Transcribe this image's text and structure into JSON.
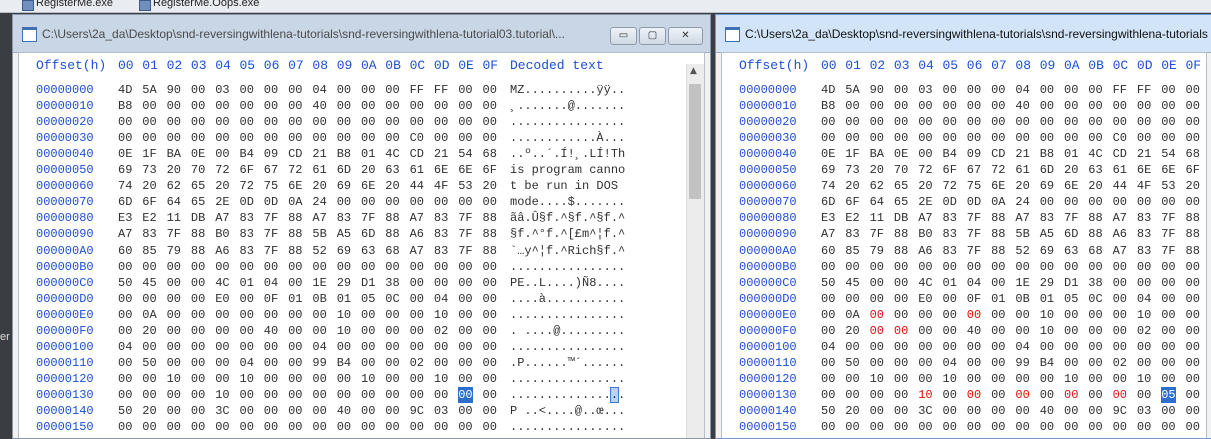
{
  "taskbar": {
    "items": [
      {
        "label": "RegisterMe.exe"
      },
      {
        "label": "RegisterMe.Oops.exe"
      }
    ],
    "side_peek": "er"
  },
  "left_window": {
    "title": "C:\\Users\\2a_da\\Desktop\\snd-reversingwithlena-tutorials\\snd-reversingwithlena-tutorial03.tutorial\\...",
    "buttons": {
      "minimize": "▭",
      "maximize": "▢",
      "close": "✕"
    },
    "header": {
      "offset": "Offset(h)",
      "columns": [
        "00",
        "01",
        "02",
        "03",
        "04",
        "05",
        "06",
        "07",
        "08",
        "09",
        "0A",
        "0B",
        "0C",
        "0D",
        "0E",
        "0F"
      ],
      "decoded": "Decoded text"
    },
    "rows": [
      {
        "offset": "00000000",
        "bytes": [
          "4D",
          "5A",
          "90",
          "00",
          "03",
          "00",
          "00",
          "00",
          "04",
          "00",
          "00",
          "00",
          "FF",
          "FF",
          "00",
          "00"
        ],
        "text": "MZ..........ÿÿ.."
      },
      {
        "offset": "00000010",
        "bytes": [
          "B8",
          "00",
          "00",
          "00",
          "00",
          "00",
          "00",
          "00",
          "40",
          "00",
          "00",
          "00",
          "00",
          "00",
          "00",
          "00"
        ],
        "text": "¸.......@......."
      },
      {
        "offset": "00000020",
        "bytes": [
          "00",
          "00",
          "00",
          "00",
          "00",
          "00",
          "00",
          "00",
          "00",
          "00",
          "00",
          "00",
          "00",
          "00",
          "00",
          "00"
        ],
        "text": "................"
      },
      {
        "offset": "00000030",
        "bytes": [
          "00",
          "00",
          "00",
          "00",
          "00",
          "00",
          "00",
          "00",
          "00",
          "00",
          "00",
          "00",
          "C0",
          "00",
          "00",
          "00"
        ],
        "text": "............À..."
      },
      {
        "offset": "00000040",
        "bytes": [
          "0E",
          "1F",
          "BA",
          "0E",
          "00",
          "B4",
          "09",
          "CD",
          "21",
          "B8",
          "01",
          "4C",
          "CD",
          "21",
          "54",
          "68"
        ],
        "text": "..º..´.Í!¸.LÍ!Th"
      },
      {
        "offset": "00000050",
        "bytes": [
          "69",
          "73",
          "20",
          "70",
          "72",
          "6F",
          "67",
          "72",
          "61",
          "6D",
          "20",
          "63",
          "61",
          "6E",
          "6E",
          "6F"
        ],
        "text": "is program canno"
      },
      {
        "offset": "00000060",
        "bytes": [
          "74",
          "20",
          "62",
          "65",
          "20",
          "72",
          "75",
          "6E",
          "20",
          "69",
          "6E",
          "20",
          "44",
          "4F",
          "53",
          "20"
        ],
        "text": "t be run in DOS "
      },
      {
        "offset": "00000070",
        "bytes": [
          "6D",
          "6F",
          "64",
          "65",
          "2E",
          "0D",
          "0D",
          "0A",
          "24",
          "00",
          "00",
          "00",
          "00",
          "00",
          "00",
          "00"
        ],
        "text": "mode....$......."
      },
      {
        "offset": "00000080",
        "bytes": [
          "E3",
          "E2",
          "11",
          "DB",
          "A7",
          "83",
          "7F",
          "88",
          "A7",
          "83",
          "7F",
          "88",
          "A7",
          "83",
          "7F",
          "88"
        ],
        "text": "ãâ.Û§f.^§f.^§f.^"
      },
      {
        "offset": "00000090",
        "bytes": [
          "A7",
          "83",
          "7F",
          "88",
          "B0",
          "83",
          "7F",
          "88",
          "5B",
          "A5",
          "6D",
          "88",
          "A6",
          "83",
          "7F",
          "88"
        ],
        "text": "§f.^°f.^[£m^¦f.^"
      },
      {
        "offset": "000000A0",
        "bytes": [
          "60",
          "85",
          "79",
          "88",
          "A6",
          "83",
          "7F",
          "88",
          "52",
          "69",
          "63",
          "68",
          "A7",
          "83",
          "7F",
          "88"
        ],
        "text": "`…y^¦f.^Rich§f.^"
      },
      {
        "offset": "000000B0",
        "bytes": [
          "00",
          "00",
          "00",
          "00",
          "00",
          "00",
          "00",
          "00",
          "00",
          "00",
          "00",
          "00",
          "00",
          "00",
          "00",
          "00"
        ],
        "text": "................"
      },
      {
        "offset": "000000C0",
        "bytes": [
          "50",
          "45",
          "00",
          "00",
          "4C",
          "01",
          "04",
          "00",
          "1E",
          "29",
          "D1",
          "38",
          "00",
          "00",
          "00",
          "00"
        ],
        "text": "PE..L....)Ñ8...."
      },
      {
        "offset": "000000D0",
        "bytes": [
          "00",
          "00",
          "00",
          "00",
          "E0",
          "00",
          "0F",
          "01",
          "0B",
          "01",
          "05",
          "0C",
          "00",
          "04",
          "00",
          "00"
        ],
        "text": "....à..........."
      },
      {
        "offset": "000000E0",
        "bytes": [
          "00",
          "0A",
          "00",
          "00",
          "00",
          "00",
          "00",
          "00",
          "00",
          "10",
          "00",
          "00",
          "00",
          "10",
          "00",
          "00"
        ],
        "text": "................"
      },
      {
        "offset": "000000F0",
        "bytes": [
          "00",
          "20",
          "00",
          "00",
          "00",
          "00",
          "40",
          "00",
          "00",
          "10",
          "00",
          "00",
          "00",
          "02",
          "00",
          "00"
        ],
        "text": ". ....@........."
      },
      {
        "offset": "00000100",
        "bytes": [
          "04",
          "00",
          "00",
          "00",
          "00",
          "00",
          "00",
          "00",
          "04",
          "00",
          "00",
          "00",
          "00",
          "00",
          "00",
          "00"
        ],
        "text": "................"
      },
      {
        "offset": "00000110",
        "bytes": [
          "00",
          "50",
          "00",
          "00",
          "00",
          "04",
          "00",
          "00",
          "99",
          "B4",
          "00",
          "00",
          "02",
          "00",
          "00",
          "00"
        ],
        "text": ".P......™´......"
      },
      {
        "offset": "00000120",
        "bytes": [
          "00",
          "00",
          "10",
          "00",
          "00",
          "10",
          "00",
          "00",
          "00",
          "00",
          "10",
          "00",
          "00",
          "10",
          "00",
          "00"
        ],
        "text": "................"
      },
      {
        "offset": "00000130",
        "bytes": [
          "00",
          "00",
          "00",
          "00",
          "10",
          "00",
          "00",
          "00",
          "00",
          "00",
          "00",
          "00",
          "00",
          "00",
          "00",
          "00"
        ],
        "text": "................"
      },
      {
        "offset": "00000140",
        "bytes": [
          "50",
          "20",
          "00",
          "00",
          "3C",
          "00",
          "00",
          "00",
          "00",
          "40",
          "00",
          "00",
          "9C",
          "03",
          "00",
          "00"
        ],
        "text": "P ..<....@..œ..."
      },
      {
        "offset": "00000150",
        "bytes": [
          "00",
          "00",
          "00",
          "00",
          "00",
          "00",
          "00",
          "00",
          "00",
          "00",
          "00",
          "00",
          "00",
          "00",
          "00",
          "00"
        ],
        "text": "................"
      },
      {
        "offset": "00000160",
        "bytes": [
          "00",
          "00",
          "00",
          "00",
          "00",
          "00",
          "00",
          "00",
          "00",
          "00",
          "00",
          "00",
          "00",
          "00",
          "00",
          "00"
        ],
        "text": "................"
      }
    ],
    "selection": {
      "row": 19,
      "col": 14
    }
  },
  "right_window": {
    "title": "C:\\Users\\2a_da\\Desktop\\snd-reversingwithlena-tutorials\\snd-reversingwithlena-tutorials",
    "header": {
      "offset": "Offset(h)",
      "columns": [
        "00",
        "01",
        "02",
        "03",
        "04",
        "05",
        "06",
        "07",
        "08",
        "09",
        "0A",
        "0B",
        "0C",
        "0D",
        "0E",
        "0F"
      ]
    },
    "rows": [
      {
        "offset": "00000000",
        "bytes": [
          "4D",
          "5A",
          "90",
          "00",
          "03",
          "00",
          "00",
          "00",
          "04",
          "00",
          "00",
          "00",
          "FF",
          "FF",
          "00",
          "00"
        ]
      },
      {
        "offset": "00000010",
        "bytes": [
          "B8",
          "00",
          "00",
          "00",
          "00",
          "00",
          "00",
          "00",
          "40",
          "00",
          "00",
          "00",
          "00",
          "00",
          "00",
          "00"
        ]
      },
      {
        "offset": "00000020",
        "bytes": [
          "00",
          "00",
          "00",
          "00",
          "00",
          "00",
          "00",
          "00",
          "00",
          "00",
          "00",
          "00",
          "00",
          "00",
          "00",
          "00"
        ]
      },
      {
        "offset": "00000030",
        "bytes": [
          "00",
          "00",
          "00",
          "00",
          "00",
          "00",
          "00",
          "00",
          "00",
          "00",
          "00",
          "00",
          "C0",
          "00",
          "00",
          "00"
        ]
      },
      {
        "offset": "00000040",
        "bytes": [
          "0E",
          "1F",
          "BA",
          "0E",
          "00",
          "B4",
          "09",
          "CD",
          "21",
          "B8",
          "01",
          "4C",
          "CD",
          "21",
          "54",
          "68"
        ]
      },
      {
        "offset": "00000050",
        "bytes": [
          "69",
          "73",
          "20",
          "70",
          "72",
          "6F",
          "67",
          "72",
          "61",
          "6D",
          "20",
          "63",
          "61",
          "6E",
          "6E",
          "6F"
        ]
      },
      {
        "offset": "00000060",
        "bytes": [
          "74",
          "20",
          "62",
          "65",
          "20",
          "72",
          "75",
          "6E",
          "20",
          "69",
          "6E",
          "20",
          "44",
          "4F",
          "53",
          "20"
        ]
      },
      {
        "offset": "00000070",
        "bytes": [
          "6D",
          "6F",
          "64",
          "65",
          "2E",
          "0D",
          "0D",
          "0A",
          "24",
          "00",
          "00",
          "00",
          "00",
          "00",
          "00",
          "00"
        ]
      },
      {
        "offset": "00000080",
        "bytes": [
          "E3",
          "E2",
          "11",
          "DB",
          "A7",
          "83",
          "7F",
          "88",
          "A7",
          "83",
          "7F",
          "88",
          "A7",
          "83",
          "7F",
          "88"
        ]
      },
      {
        "offset": "00000090",
        "bytes": [
          "A7",
          "83",
          "7F",
          "88",
          "B0",
          "83",
          "7F",
          "88",
          "5B",
          "A5",
          "6D",
          "88",
          "A6",
          "83",
          "7F",
          "88"
        ]
      },
      {
        "offset": "000000A0",
        "bytes": [
          "60",
          "85",
          "79",
          "88",
          "A6",
          "83",
          "7F",
          "88",
          "52",
          "69",
          "63",
          "68",
          "A7",
          "83",
          "7F",
          "88"
        ]
      },
      {
        "offset": "000000B0",
        "bytes": [
          "00",
          "00",
          "00",
          "00",
          "00",
          "00",
          "00",
          "00",
          "00",
          "00",
          "00",
          "00",
          "00",
          "00",
          "00",
          "00"
        ]
      },
      {
        "offset": "000000C0",
        "bytes": [
          "50",
          "45",
          "00",
          "00",
          "4C",
          "01",
          "04",
          "00",
          "1E",
          "29",
          "D1",
          "38",
          "00",
          "00",
          "00",
          "00"
        ]
      },
      {
        "offset": "000000D0",
        "bytes": [
          "00",
          "00",
          "00",
          "00",
          "E0",
          "00",
          "0F",
          "01",
          "0B",
          "01",
          "05",
          "0C",
          "00",
          "04",
          "00",
          "00"
        ]
      },
      {
        "offset": "000000E0",
        "bytes": [
          "00",
          "0A",
          "00",
          "00",
          "00",
          "00",
          "00",
          "00",
          "00",
          "10",
          "00",
          "00",
          "00",
          "10",
          "00",
          "00"
        ]
      },
      {
        "offset": "000000F0",
        "bytes": [
          "00",
          "20",
          "00",
          "00",
          "00",
          "00",
          "40",
          "00",
          "00",
          "10",
          "00",
          "00",
          "00",
          "02",
          "00",
          "00"
        ]
      },
      {
        "offset": "00000100",
        "bytes": [
          "04",
          "00",
          "00",
          "00",
          "00",
          "00",
          "00",
          "00",
          "04",
          "00",
          "00",
          "00",
          "00",
          "00",
          "00",
          "00"
        ]
      },
      {
        "offset": "00000110",
        "bytes": [
          "00",
          "50",
          "00",
          "00",
          "00",
          "04",
          "00",
          "00",
          "99",
          "B4",
          "00",
          "00",
          "02",
          "00",
          "00",
          "00"
        ]
      },
      {
        "offset": "00000120",
        "bytes": [
          "00",
          "00",
          "10",
          "00",
          "00",
          "10",
          "00",
          "00",
          "00",
          "00",
          "10",
          "00",
          "00",
          "10",
          "00",
          "00"
        ]
      },
      {
        "offset": "00000130",
        "bytes": [
          "00",
          "00",
          "00",
          "00",
          "10",
          "00",
          "00",
          "00",
          "00",
          "00",
          "00",
          "00",
          "00",
          "00",
          "05",
          "00"
        ]
      },
      {
        "offset": "00000140",
        "bytes": [
          "50",
          "20",
          "00",
          "00",
          "3C",
          "00",
          "00",
          "00",
          "00",
          "40",
          "00",
          "00",
          "9C",
          "03",
          "00",
          "00"
        ]
      },
      {
        "offset": "00000150",
        "bytes": [
          "00",
          "00",
          "00",
          "00",
          "00",
          "00",
          "00",
          "00",
          "00",
          "00",
          "00",
          "00",
          "00",
          "00",
          "00",
          "00"
        ]
      },
      {
        "offset": "00000160",
        "bytes": [
          "00",
          "00",
          "00",
          "00",
          "00",
          "00",
          "00",
          "00",
          "00",
          "00",
          "00",
          "00",
          "00",
          "00",
          "00",
          "00"
        ]
      }
    ],
    "changed": [
      [
        14,
        2
      ],
      [
        14,
        6
      ],
      [
        15,
        2
      ],
      [
        15,
        3
      ],
      [
        19,
        4
      ],
      [
        19,
        6
      ],
      [
        19,
        8
      ],
      [
        19,
        10
      ],
      [
        19,
        12
      ]
    ],
    "selection": {
      "row": 19,
      "col": 14
    }
  },
  "colors": {
    "offset_blue": "#1c4fd6",
    "changed_red": "#e01010",
    "selection_blue": "#2c6fcf"
  }
}
